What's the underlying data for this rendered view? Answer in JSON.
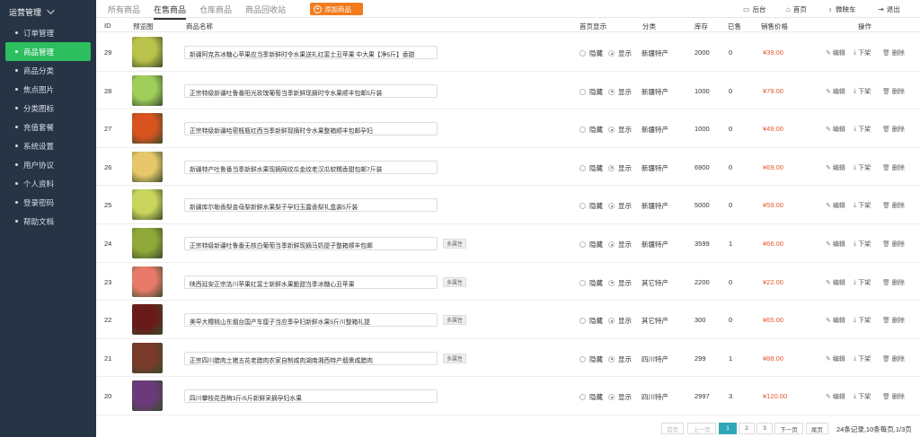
{
  "sidebar": {
    "heading": "运营管理",
    "items": [
      {
        "label": "订单管理",
        "active": false
      },
      {
        "label": "商品管理",
        "active": true
      },
      {
        "label": "商品分类",
        "active": false
      },
      {
        "label": "焦点图片",
        "active": false
      },
      {
        "label": "分类图标",
        "active": false
      },
      {
        "label": "充值套餐",
        "active": false
      },
      {
        "label": "系统设置",
        "active": false
      },
      {
        "label": "用户协议",
        "active": false
      },
      {
        "label": "个人资料",
        "active": false
      },
      {
        "label": "登录密码",
        "active": false
      },
      {
        "label": "帮助文档",
        "active": false
      }
    ]
  },
  "tabs": [
    "所有商品",
    "在售商品",
    "仓库商品",
    "商品回收站"
  ],
  "active_tab": "在售商品",
  "add_button": "添加商品",
  "top_links": [
    {
      "label": "后台",
      "icon": "monitor-icon"
    },
    {
      "label": "首页",
      "icon": "home-icon"
    },
    {
      "label": "微映车",
      "icon": "shirt-icon"
    },
    {
      "label": "退出",
      "icon": "logout-icon"
    }
  ],
  "columns": [
    "ID",
    "预览图",
    "商品名称",
    "首页显示",
    "分类",
    "库存",
    "已售",
    "销售价格",
    "操作"
  ],
  "radio_labels": {
    "hide": "隐藏",
    "show": "显示"
  },
  "attr_label": "多属性",
  "actions": {
    "edit": "编辑",
    "offshelf": "下架",
    "delete": "删除"
  },
  "rows": [
    {
      "id": "29",
      "name": "新疆阿克苏冰糖心苹果应当季新鲜时令水果送礼红富士丑苹果 中大果【净5斤】香甜",
      "attr": false,
      "category": "新疆特产",
      "stock": "2000",
      "sold": "0",
      "price": "¥39.00",
      "thumb_color": "#b9c24a"
    },
    {
      "id": "28",
      "name": "正宗特级新疆吐鲁番阳光玫瑰葡萄当季新鲜现摘时令水果顺丰包邮5斤装",
      "attr": false,
      "category": "新疆特产",
      "stock": "1000",
      "sold": "0",
      "price": "¥79.00",
      "thumb_color": "#9fcf5a"
    },
    {
      "id": "27",
      "name": "正宗特级新疆哈密瓶瓶红西当季新鲜现摘时令水果整箱顺丰包邮孕妇",
      "attr": false,
      "category": "新疆特产",
      "stock": "1000",
      "sold": "0",
      "price": "¥49.00",
      "thumb_color": "#d9531e"
    },
    {
      "id": "26",
      "name": "新疆特产吐鲁番当季新鲜水果现摘网纹瓜金纹老汉瓜软糯香甜包邮7斤装",
      "attr": false,
      "category": "新疆特产",
      "stock": "6900",
      "sold": "0",
      "price": "¥69.00",
      "thumb_color": "#e6c86a"
    },
    {
      "id": "25",
      "name": "新疆库尔勒香梨金母梨新鲜水果梨子孕妇玉露香梨礼盒装5斤装",
      "attr": false,
      "category": "新疆特产",
      "stock": "5000",
      "sold": "0",
      "price": "¥59.00",
      "thumb_color": "#c9d45c"
    },
    {
      "id": "24",
      "name": "正宗特级新疆吐鲁番无核白葡萄当季新鲜现摘马奶提子整箱顺丰包邮",
      "attr": true,
      "category": "新疆特产",
      "stock": "3599",
      "sold": "1",
      "price": "¥66.00",
      "thumb_color": "#8fa838"
    },
    {
      "id": "23",
      "name": "陕西延安正宗洛川苹果红富士新鲜水果脆甜当季冰糖心丑苹果",
      "attr": true,
      "category": "其它特产",
      "stock": "2200",
      "sold": "0",
      "price": "¥22.00",
      "thumb_color": "#e87a6a"
    },
    {
      "id": "22",
      "name": "美早大樱桃山东烟台国产车厘子当应季孕妇新鲜水果5斤川整箱礼提",
      "attr": true,
      "category": "其它特产",
      "stock": "300",
      "sold": "0",
      "price": "¥65.00",
      "thumb_color": "#6b1a1a"
    },
    {
      "id": "21",
      "name": "正宗四川腊肉土猪五花老腊肉农家自制咸肉湖南湘西特产烟熏咸腊肉",
      "attr": true,
      "category": "四川特产",
      "stock": "299",
      "sold": "1",
      "price": "¥88.00",
      "thumb_color": "#7a3a2a"
    },
    {
      "id": "20",
      "name": "四川攀枝花西梅3斤/5斤新鲜采摘孕妇水果",
      "attr": false,
      "category": "四川特产",
      "stock": "2997",
      "sold": "3",
      "price": "¥120.00",
      "thumb_color": "#6a3a7a"
    }
  ],
  "pagination": {
    "first": "首页",
    "prev": "上一页",
    "pages": [
      "1",
      "2",
      "3"
    ],
    "current": "1",
    "next": "下一页",
    "last": "尾页",
    "info": "24条记录,10条每页,1/3页"
  }
}
